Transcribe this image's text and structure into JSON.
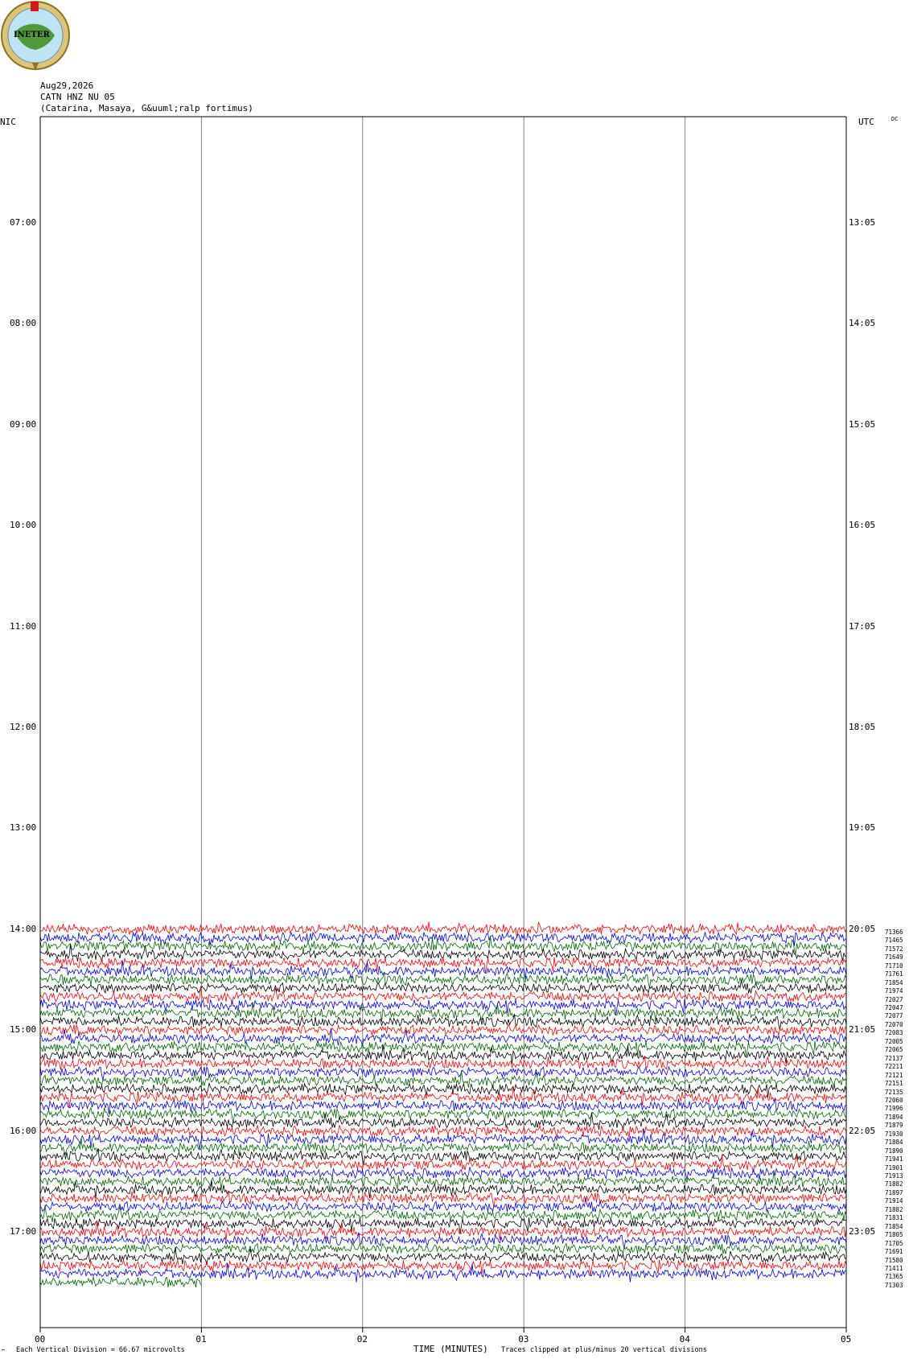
{
  "logo": {
    "text": "INETER"
  },
  "header": {
    "date": "Aug29,2026",
    "station": "CATN HNZ NU 05",
    "location": "(Catarina, Masaya, G&uuml;ralp fortimus)"
  },
  "left_zone": "NIC",
  "right_zone": "UTC",
  "dc_label": "DC",
  "colors": {
    "red": "#ff0000",
    "blue": "#0000ff",
    "green": "#006600",
    "black": "#000000",
    "grid": "#808080"
  },
  "chart_data": {
    "type": "line",
    "title": "",
    "xlabel": "TIME (MINUTES)",
    "ylabel": "",
    "x_ticks": [
      "00",
      "01",
      "02",
      "03",
      "04",
      "05"
    ],
    "xlim": [
      0,
      5
    ],
    "left_hour_labels": [
      "07:00",
      "08:00",
      "09:00",
      "10:00",
      "11:00",
      "12:00",
      "13:00",
      "14:00",
      "15:00",
      "16:00",
      "17:00"
    ],
    "right_hour_labels": [
      "13:05",
      "14:05",
      "15:05",
      "16:05",
      "17:05",
      "18:05",
      "19:05",
      "20:05",
      "21:05",
      "22:05",
      "23:05"
    ],
    "traces_per_hour": 12,
    "trace_start": "14:00",
    "trace_color_cycle": [
      "red",
      "blue",
      "green",
      "black"
    ],
    "last_trace_end_minute": 1.0,
    "trace_counts": [
      "71366",
      "71465",
      "71572",
      "71649",
      "71710",
      "71761",
      "71854",
      "71974",
      "72027",
      "72047",
      "72077",
      "72070",
      "72083",
      "72005",
      "72065",
      "72137",
      "72211",
      "72121",
      "72151",
      "72135",
      "72060",
      "71996",
      "71894",
      "71879",
      "71930",
      "71884",
      "71890",
      "71941",
      "71901",
      "71913",
      "71882",
      "71897",
      "71914",
      "71882",
      "71831",
      "71854",
      "71805",
      "71705",
      "71691",
      "71580",
      "71411",
      "71365",
      "71303"
    ]
  },
  "footer": {
    "scale_note": "Each Vertical Division =   66.67 microvolts",
    "clip_note": "Traces clipped at plus/minus 20 vertical divisions"
  }
}
